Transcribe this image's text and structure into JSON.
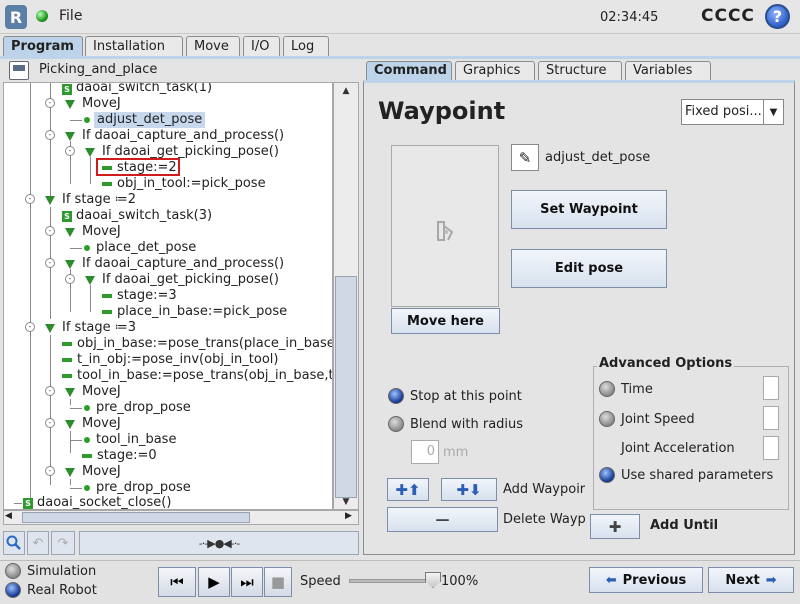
{
  "topbar": {
    "logo": "R",
    "file_label": "File",
    "clock": "02:34:45",
    "robot_name": "CCCC",
    "help_label": "?"
  },
  "main_tabs": [
    "Program",
    "Installation",
    "Move",
    "I/O",
    "Log"
  ],
  "program": {
    "name": "Picking_and_place"
  },
  "tree": [
    {
      "text": "daoai_switch_task(1)"
    },
    {
      "text": "MoveJ"
    },
    {
      "text": "adjust_det_pose"
    },
    {
      "text": "If daoai_capture_and_process()"
    },
    {
      "text": "If daoai_get_picking_pose()"
    },
    {
      "text": "stage:=2"
    },
    {
      "text": "obj_in_tool:=pick_pose"
    },
    {
      "text": "If stage ≔2"
    },
    {
      "text": "daoai_switch_task(3)"
    },
    {
      "text": "MoveJ"
    },
    {
      "text": "place_det_pose"
    },
    {
      "text": "If daoai_capture_and_process()"
    },
    {
      "text": "If daoai_get_picking_pose()"
    },
    {
      "text": "stage:=3"
    },
    {
      "text": "place_in_base:=pick_pose"
    },
    {
      "text": "If stage ≔3"
    },
    {
      "text": "obj_in_base:=pose_trans(place_in_base,o"
    },
    {
      "text": "t_in_obj:=pose_inv(obj_in_tool)"
    },
    {
      "text": "tool_in_base:=pose_trans(obj_in_base,t_i"
    },
    {
      "text": "MoveJ"
    },
    {
      "text": "pre_drop_pose"
    },
    {
      "text": "MoveJ"
    },
    {
      "text": "tool_in_base"
    },
    {
      "text": "stage:=0"
    },
    {
      "text": "MoveJ"
    },
    {
      "text": "pre_drop_pose"
    },
    {
      "text": "daoai_socket_close()"
    }
  ],
  "command_tabs": [
    "Command",
    "Graphics",
    "Structure",
    "Variables"
  ],
  "waypoint": {
    "title": "Waypoint",
    "type_select": "Fixed posi...",
    "pose_name": "adjust_det_pose",
    "set_waypoint": "Set Waypoint",
    "edit_pose": "Edit pose",
    "move_here": "Move here",
    "stop_label": "Stop at this point",
    "blend_label": "Blend with radius",
    "radius_value": "0",
    "radius_unit": "mm",
    "add_waypoint": "Add Waypoir",
    "delete_waypoint": "Delete Wayp",
    "add_until": "Add Until"
  },
  "advanced": {
    "title": "Advanced Options",
    "time": "Time",
    "joint_speed": "Joint Speed",
    "joint_accel": "Joint Acceleration",
    "shared": "Use shared parameters"
  },
  "bottom": {
    "simulation": "Simulation",
    "real_robot": "Real Robot",
    "speed_label": "Speed",
    "speed_value": "100%",
    "previous": "Previous",
    "next": "Next"
  }
}
